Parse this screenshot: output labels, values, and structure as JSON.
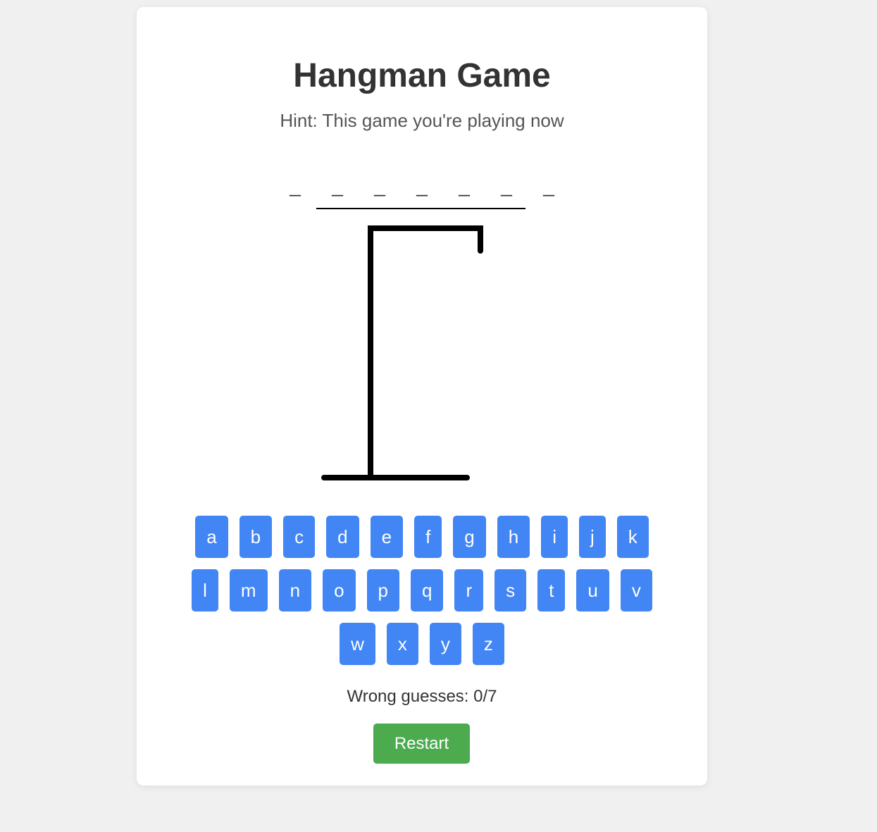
{
  "title": "Hangman Game",
  "hint": "Hint: This game you're playing now",
  "word_slots": [
    "_",
    "_",
    "_",
    "_",
    "_",
    "_",
    "_"
  ],
  "letters": [
    "a",
    "b",
    "c",
    "d",
    "e",
    "f",
    "g",
    "h",
    "i",
    "j",
    "k",
    "l",
    "m",
    "n",
    "o",
    "p",
    "q",
    "r",
    "s",
    "t",
    "u",
    "v",
    "w",
    "x",
    "y",
    "z"
  ],
  "wrong_guesses": "Wrong guesses: 0/7",
  "wrong_count": 0,
  "max_wrong": 7,
  "restart_label": "Restart",
  "colors": {
    "background": "#f0f0f0",
    "card": "#ffffff",
    "key": "#4285f4",
    "restart": "#4caa4f",
    "text": "#333333"
  }
}
